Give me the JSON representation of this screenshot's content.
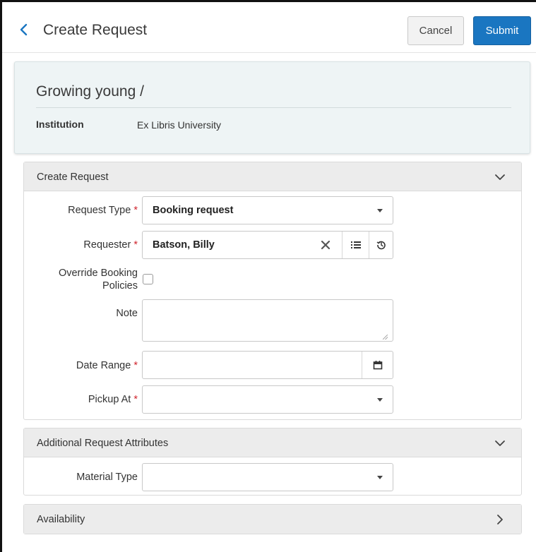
{
  "header": {
    "title": "Create Request",
    "cancel_label": "Cancel",
    "submit_label": "Submit"
  },
  "record": {
    "title": "Growing young /",
    "institution_label": "Institution",
    "institution_value": "Ex Libris University"
  },
  "create_request": {
    "section_title": "Create Request",
    "request_type_label": "Request Type",
    "request_type_value": "Booking request",
    "requester_label": "Requester",
    "requester_value": "Batson, Billy",
    "override_label_line1": "Override Booking",
    "override_label_line2": "Policies",
    "override_checked": false,
    "note_label": "Note",
    "note_value": "",
    "date_range_label": "Date Range",
    "date_range_value": "",
    "pickup_label": "Pickup At",
    "pickup_value": "",
    "required_mark": "*"
  },
  "additional": {
    "section_title": "Additional Request Attributes",
    "material_type_label": "Material Type",
    "material_type_value": ""
  },
  "availability": {
    "section_title": "Availability"
  },
  "icons": {
    "back": "chevron-left-icon",
    "clear": "close-x-icon",
    "list": "list-icon",
    "history": "history-icon",
    "calendar": "calendar-icon",
    "expanded": "chevron-down-icon",
    "collapsed": "chevron-right-icon"
  },
  "colors": {
    "accent": "#1a76c1",
    "required": "#d0262f",
    "card_bg": "#eef4f5",
    "section_head_bg": "#ececec"
  }
}
